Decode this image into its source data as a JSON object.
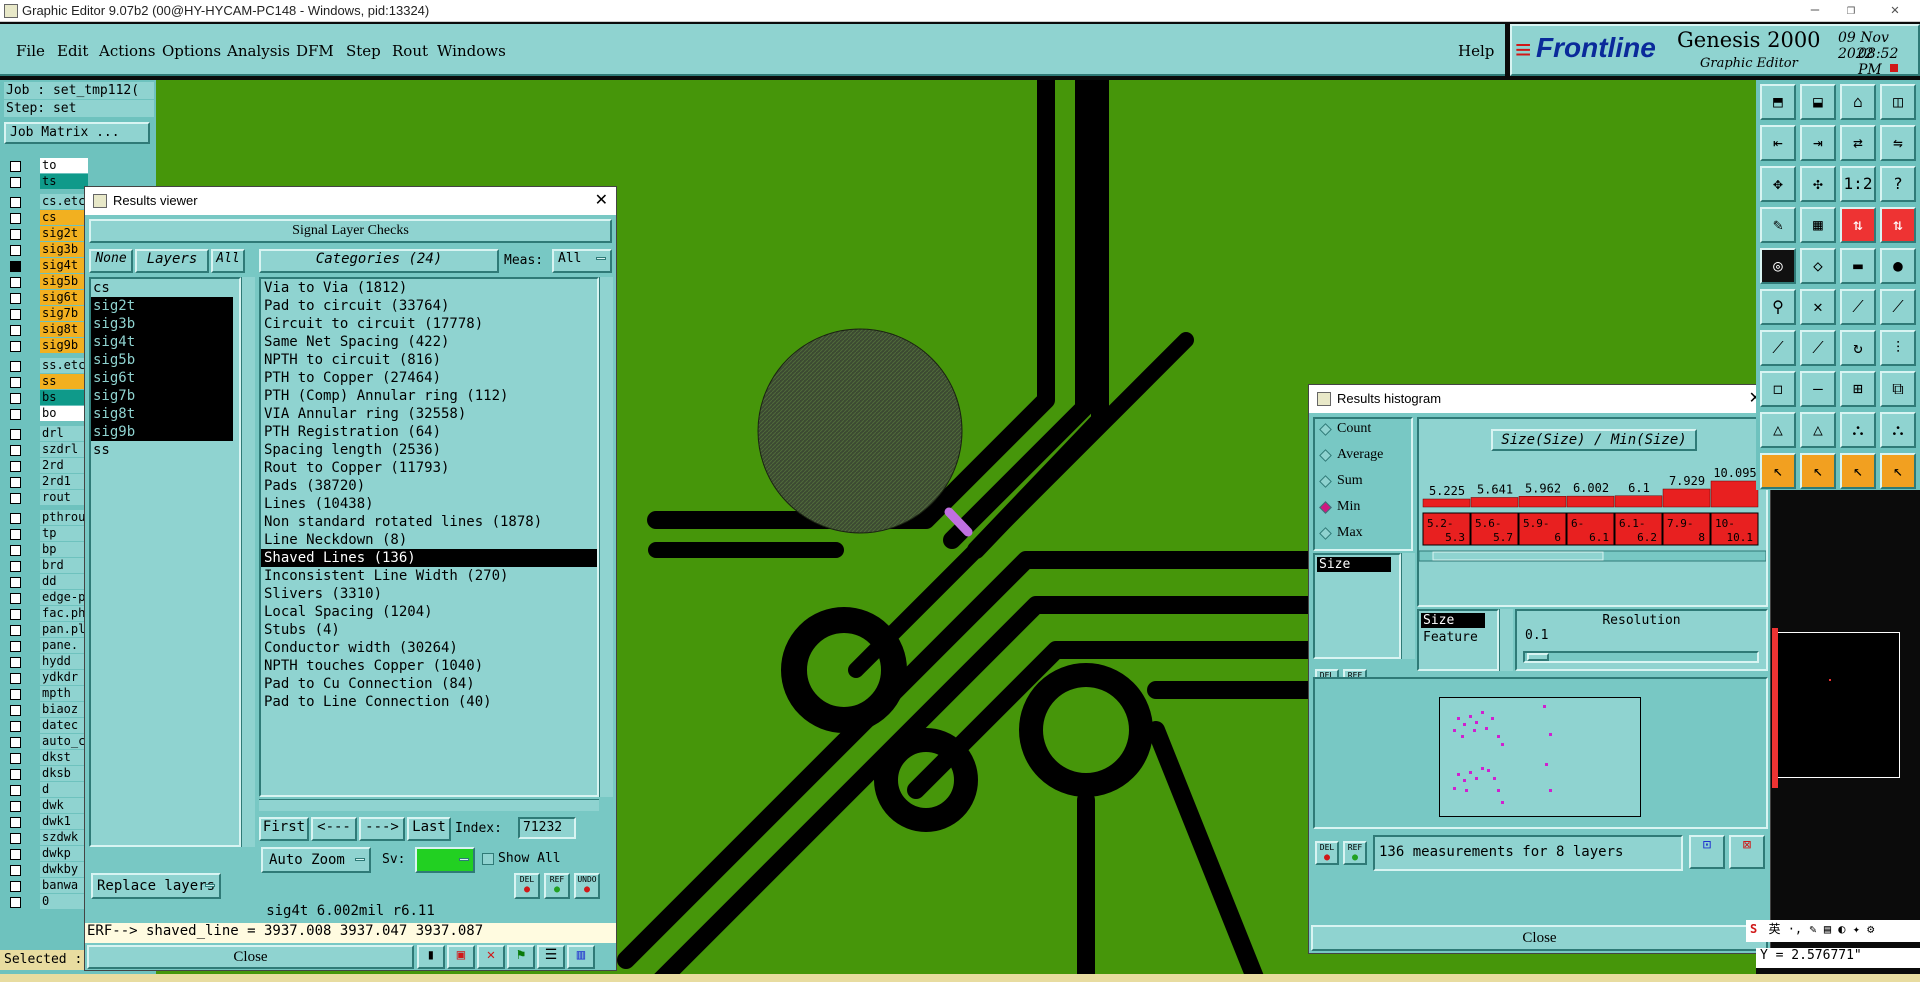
{
  "window": {
    "title": "Graphic Editor 9.07b2 (00@HY-HYCAM-PC148 - Windows, pid:13324)"
  },
  "menu": {
    "items": [
      "File",
      "Edit",
      "Actions",
      "Options",
      "Analysis",
      "DFM",
      "Step",
      "Rout",
      "Windows"
    ],
    "help": "Help"
  },
  "brand": {
    "logo": "Frontline",
    "product": "Genesis 2000",
    "sub": "Graphic Editor",
    "date": "09 Nov 2022",
    "time": "08:52 PM"
  },
  "left": {
    "job": "Job : set_tmp112(",
    "step": "Step: set",
    "job_matrix": "Job Matrix ...",
    "layers": [
      "to",
      "ts",
      "cs.etc",
      "cs",
      "sig2t",
      "sig3b",
      "sig4t",
      "sig5b",
      "sig6t",
      "sig7b",
      "sig8t",
      "sig9b",
      "ss.etc",
      "ss",
      "bs",
      "bo",
      "drl",
      "szdrl",
      "2rd",
      "2rd1",
      "rout",
      "pthrou",
      "tp",
      "bp",
      "brd",
      "dd",
      "edge-p",
      "fac.ph",
      "pan.pl",
      "pane.",
      "hydd",
      "ydkdr",
      "mpth",
      "biaoz",
      "datec",
      "auto_c",
      "dkst",
      "dksb",
      "d",
      "dwk",
      "dwk1",
      "szdwk",
      "dwkp",
      "dwkby",
      "banwa",
      "0"
    ],
    "selected": "Selected :"
  },
  "results_viewer": {
    "title": "Results viewer",
    "header": "Signal Layer Checks",
    "none": "None",
    "layers": "Layers",
    "all": "All",
    "categories_label": "Categories (24)",
    "meas_label": "Meas:",
    "meas_value": "All",
    "layer_list": [
      "cs",
      "sig2t",
      "sig3b",
      "sig4t",
      "sig5b",
      "sig6t",
      "sig7b",
      "sig8t",
      "sig9b",
      "ss"
    ],
    "categories": [
      "Via to Via (1812)",
      "Pad to circuit (33764)",
      "Circuit to circuit (17778)",
      "Same Net Spacing (422)",
      "NPTH to circuit (816)",
      "PTH to Copper (27464)",
      "PTH (Comp) Annular ring (112)",
      "VIA Annular ring (32558)",
      "PTH Registration (64)",
      "Spacing length (2536)",
      "Rout to Copper (11793)",
      "Pads (38720)",
      "Lines (10438)",
      "Non standard rotated lines (1878)",
      "Line Neckdown (8)",
      "Shaved Lines (136)",
      "Inconsistent Line Width (270)",
      "Slivers (3310)",
      "Local Spacing (1204)",
      "Stubs (4)",
      "Conductor width (30264)",
      "NPTH touches Copper (1040)",
      "Pad to Cu Connection (84)",
      "Pad to Line Connection (40)"
    ],
    "selected_category": "Shaved Lines (136)",
    "first": "First",
    "prev": "<---",
    "next": "--->",
    "last": "Last",
    "index_label": "Index:",
    "index_value": "71232",
    "auto_zoom": "Auto Zoom",
    "sv_label": "Sv:",
    "show_all": "Show All",
    "replace_layers": "Replace layers",
    "del": "DEL",
    "ref": "REF",
    "undo": "UNDO",
    "status": "sig4t 6.002mil  r6.11",
    "erf": "ERF--> shaved_line = 3937.008 3937.047 3937.087",
    "close": "Close"
  },
  "histogram": {
    "title": "Results histogram",
    "modes": [
      "Count",
      "Average",
      "Sum",
      "Min",
      "Max"
    ],
    "selected_mode": "Min",
    "chart_title": "Size(Size) / Min(Size)",
    "list_item": "Size",
    "chart_data": {
      "type": "bar",
      "categories": [
        "5.2-5.3",
        "5.6-5.7",
        "5.9-6",
        "6-6.1",
        "6.1-6.2",
        "7.9-8",
        "10-10.1"
      ],
      "values": [
        5.225,
        5.641,
        5.962,
        6.002,
        6.1,
        7.929,
        10.095
      ]
    },
    "options": [
      "Size",
      "Feature"
    ],
    "resolution_label": "Resolution",
    "resolution_value": "0.1",
    "summary": "136 measurements for 8 layers",
    "del": "DEL",
    "ref": "REF",
    "close": "Close"
  },
  "status": {
    "coord": "Y = 2.576771\""
  },
  "colors": {
    "board": "#46960a",
    "panel": "#8fd3d0",
    "highlight": "#000000",
    "bar": "#e82020"
  }
}
